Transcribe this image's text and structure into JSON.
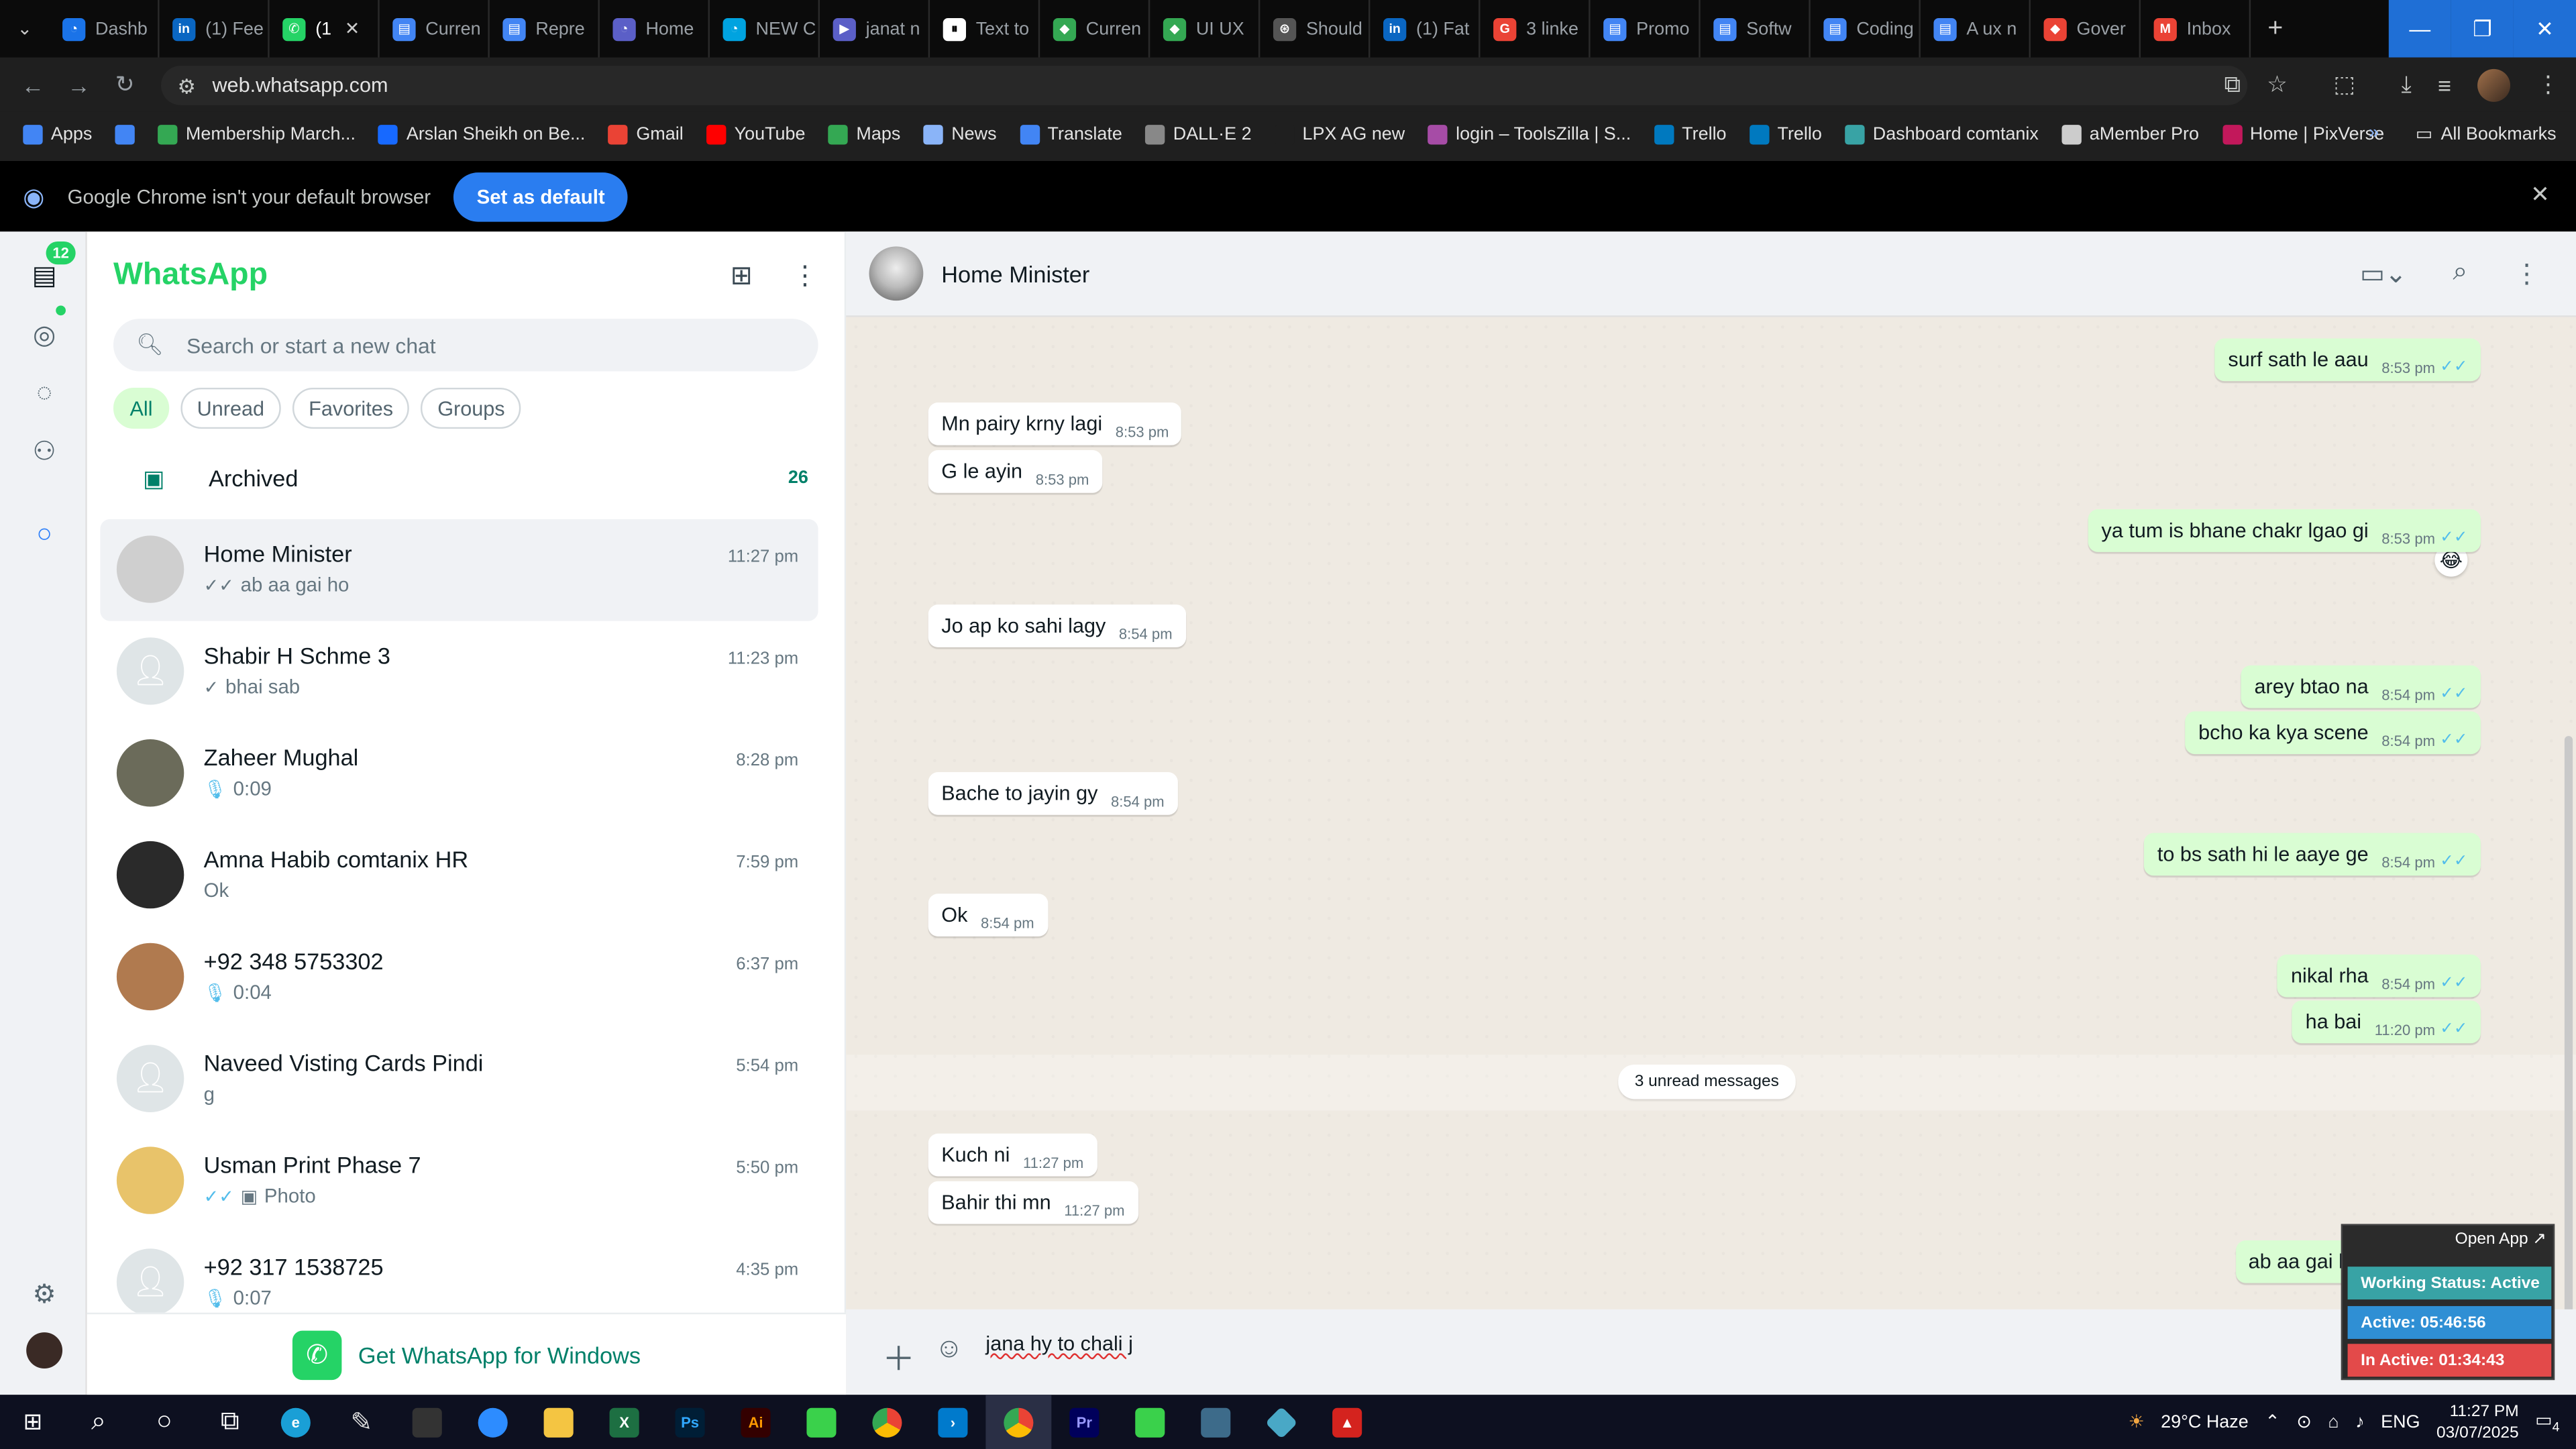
{
  "browser": {
    "tabs": [
      {
        "label": "Dashb",
        "color": "#1a73e8",
        "glyph": "◔"
      },
      {
        "label": "(1) Fee",
        "color": "#0a66c2",
        "glyph": "in"
      },
      {
        "label": "(1",
        "color": "#25d366",
        "glyph": "✆",
        "active": true
      },
      {
        "label": "Curren",
        "color": "#4285f4",
        "glyph": "▤"
      },
      {
        "label": "Repre",
        "color": "#4285f4",
        "glyph": "▤"
      },
      {
        "label": "Home",
        "color": "#5b5fc7",
        "glyph": "◔"
      },
      {
        "label": "NEW C",
        "color": "#00a3e0",
        "glyph": "◔"
      },
      {
        "label": "janat n",
        "color": "#5b5fc7",
        "glyph": "▶"
      },
      {
        "label": "Text to",
        "color": "#ffffff",
        "glyph": "⏸"
      },
      {
        "label": "Curren",
        "color": "#34a853",
        "glyph": "◆"
      },
      {
        "label": "UI UX",
        "color": "#34a853",
        "glyph": "◆"
      },
      {
        "label": "Should",
        "color": "#555555",
        "glyph": "⊛"
      },
      {
        "label": "(1) Fat",
        "color": "#0a66c2",
        "glyph": "in"
      },
      {
        "label": "3 linke",
        "color": "#ea4335",
        "glyph": "G"
      },
      {
        "label": "Promo",
        "color": "#4285f4",
        "glyph": "▤"
      },
      {
        "label": "Softw",
        "color": "#4285f4",
        "glyph": "▤"
      },
      {
        "label": "Coding",
        "color": "#4285f4",
        "glyph": "▤"
      },
      {
        "label": "A ux n",
        "color": "#4285f4",
        "glyph": "▤"
      },
      {
        "label": "Gover",
        "color": "#ea4335",
        "glyph": "◆"
      },
      {
        "label": "Inbox",
        "color": "#ea4335",
        "glyph": "M"
      }
    ],
    "url": "web.whatsapp.com",
    "bookmarks": [
      {
        "label": "Apps",
        "color": "#4285f4"
      },
      {
        "label": "",
        "color": "#4285f4"
      },
      {
        "label": "Membership March...",
        "color": "#34a853"
      },
      {
        "label": "Arslan Sheikh on Be...",
        "color": "#1769ff"
      },
      {
        "label": "Gmail",
        "color": "#ea4335"
      },
      {
        "label": "YouTube",
        "color": "#ff0000"
      },
      {
        "label": "Maps",
        "color": "#34a853"
      },
      {
        "label": "News",
        "color": "#8ab4f8"
      },
      {
        "label": "Translate",
        "color": "#4285f4"
      },
      {
        "label": "DALL·E 2",
        "color": "#888888"
      },
      {
        "label": "LPX AG new",
        "color": "#1f1f1f"
      },
      {
        "label": "login – ToolsZilla | S...",
        "color": "#a64ca6"
      },
      {
        "label": "Trello",
        "color": "#0079bf"
      },
      {
        "label": "Trello",
        "color": "#0079bf"
      },
      {
        "label": "Dashboard comtanix",
        "color": "#38a3a5"
      },
      {
        "label": "aMember Pro",
        "color": "#cccccc"
      },
      {
        "label": "Home | PixVerse",
        "color": "#c2185b"
      }
    ],
    "all_bookmarks": "All Bookmarks",
    "infobar": {
      "message": "Google Chrome isn't your default browser",
      "button": "Set as default"
    }
  },
  "whatsapp": {
    "brand": "WhatsApp",
    "rail_badge": "12",
    "search_placeholder": "Search or start a new chat",
    "filters": [
      "All",
      "Unread",
      "Favorites",
      "Groups"
    ],
    "archived": {
      "label": "Archived",
      "count": "26"
    },
    "chats": [
      {
        "name": "Home Minister",
        "preview": "ab aa gai ho",
        "time": "11:27 pm",
        "prefix": "tick",
        "avatar_color": "#cfcfcf",
        "selected": true
      },
      {
        "name": "Shabir H  Schme 3",
        "preview": "bhai sab",
        "time": "11:23 pm",
        "prefix": "tick1",
        "avatar_color": "#dfe5e7"
      },
      {
        "name": "Zaheer Mughal",
        "preview": "0:09",
        "time": "8:28 pm",
        "prefix": "mic",
        "avatar_color": "#6b6b5a"
      },
      {
        "name": "Amna Habib comtanix HR",
        "preview": "Ok",
        "time": "7:59 pm",
        "prefix": "",
        "avatar_color": "#2a2a2a"
      },
      {
        "name": "+92 348 5753302",
        "preview": "0:04",
        "time": "6:37 pm",
        "prefix": "mic",
        "avatar_color": "#b07a4f"
      },
      {
        "name": "Naveed Visting Cards Pindi",
        "preview": "g",
        "time": "5:54 pm",
        "prefix": "",
        "avatar_color": "#dfe5e7"
      },
      {
        "name": "Usman Print Phase 7",
        "preview": "Photo",
        "time": "5:50 pm",
        "prefix": "photo",
        "avatar_color": "#e8c36a"
      },
      {
        "name": "+92 317 1538725",
        "preview": "0:07",
        "time": "4:35 pm",
        "prefix": "mic",
        "avatar_color": "#dfe5e7"
      }
    ],
    "get_windows": "Get WhatsApp for Windows",
    "conversation": {
      "contact": "Home Minister",
      "messages": [
        {
          "text": "surf sath le aau",
          "time": "8:53 pm",
          "out": true
        },
        {
          "text": "Mn pairy krny lagi",
          "time": "8:53 pm",
          "out": false
        },
        {
          "text": "G le ayin",
          "time": "8:53 pm",
          "out": false
        },
        {
          "text": "ya tum is bhane chakr lgao gi",
          "time": "8:53 pm",
          "out": true
        },
        {
          "text": "Jo ap ko sahi lagy",
          "time": "8:54 pm",
          "out": false
        },
        {
          "text": "arey btao na",
          "time": "8:54 pm",
          "out": true
        },
        {
          "text": "bcho ka kya scene",
          "time": "8:54 pm",
          "out": true
        },
        {
          "text": "Bache to jayin gy",
          "time": "8:54 pm",
          "out": false
        },
        {
          "text": "to bs sath hi le aaye ge",
          "time": "8:54 pm",
          "out": true
        },
        {
          "text": "Ok",
          "time": "8:54 pm",
          "out": false
        },
        {
          "text": "nikal rha",
          "time": "8:54 pm",
          "out": true
        },
        {
          "text": "ha bai",
          "time": "11:20 pm",
          "out": true
        },
        {
          "text": "Kuch ni",
          "time": "11:27 pm",
          "out": false
        },
        {
          "text": "Bahir thi mn",
          "time": "11:27 pm",
          "out": false
        },
        {
          "text": "ab aa gai ho",
          "time": "11:27 pm",
          "out": true
        }
      ],
      "unread_divider": "3 unread messages",
      "reaction": "😂",
      "draft": "jana hy to chali j"
    },
    "tracker": {
      "open_app": "Open App ↗",
      "status": "Working Status: Active",
      "active": "Active: 05:46:56",
      "inactive": "In Active: 01:34:43"
    }
  },
  "taskbar": {
    "weather": "29°C  Haze",
    "lang": "ENG",
    "time": "11:27 PM",
    "date": "03/07/2025",
    "notif_count": "4"
  }
}
